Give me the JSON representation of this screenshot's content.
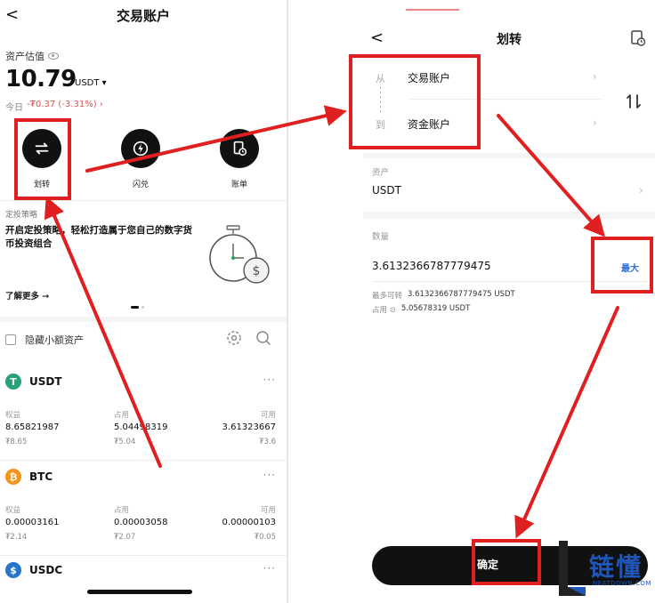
{
  "left": {
    "title": "交易账户",
    "back": "<",
    "estimate_label": "资产估值",
    "amount": "10.79",
    "unit": "USDT ▾",
    "today_label": "今日",
    "today_change": "-₮0.37 (-3.31%) ›",
    "actions": [
      {
        "label": "划转"
      },
      {
        "label": "闪兑"
      },
      {
        "label": "账单"
      }
    ],
    "strategy": {
      "tag": "定投策略",
      "text": "开启定投策略，轻松打造属于您自己的数字货币投资组合",
      "learn_more": "了解更多 →"
    },
    "hide_small": "隐藏小额资产",
    "assets": [
      {
        "name": "USDT",
        "icon_letter": "T",
        "icon_color": "#26a17b",
        "more": "···",
        "captions": [
          "权益",
          "占用",
          "可用"
        ],
        "values": [
          "8.65821987",
          "5.04498319",
          "3.61323667"
        ],
        "subs": [
          "₮8.65",
          "₮5.04",
          "₮3.6"
        ]
      },
      {
        "name": "BTC",
        "icon_letter": "₿",
        "icon_color": "#f7931a",
        "more": "···",
        "captions": [
          "权益",
          "占用",
          "可用"
        ],
        "values": [
          "0.00003161",
          "0.00003058",
          "0.00000103"
        ],
        "subs": [
          "₮2.14",
          "₮2.07",
          "₮0.05"
        ]
      },
      {
        "name": "USDC",
        "icon_letter": "$",
        "icon_color": "#2775ca",
        "more": "···"
      }
    ]
  },
  "right": {
    "back": "<",
    "title": "划转",
    "from_label": "从",
    "from_value": "交易账户",
    "to_label": "到",
    "to_value": "资金账户",
    "chevron": "›",
    "asset_label": "资产",
    "asset_value": "USDT",
    "qty_label": "数量",
    "qty_value": "3.6132366787779475",
    "max_label": "最大",
    "max_transfer_label": "最多可转",
    "max_transfer_value": "3.6132366787779475 USDT",
    "occupied_label": "占用 ⊙",
    "occupied_value": "5.05678319 USDT",
    "confirm": "确定"
  },
  "watermark": {
    "name": "链懂",
    "site": "NEATDOWN.COM",
    "color": "#1f56b8"
  },
  "colors": {
    "highlight": "#e02020",
    "accent_blue": "#2f6fd6",
    "negative": "#d9534f"
  }
}
